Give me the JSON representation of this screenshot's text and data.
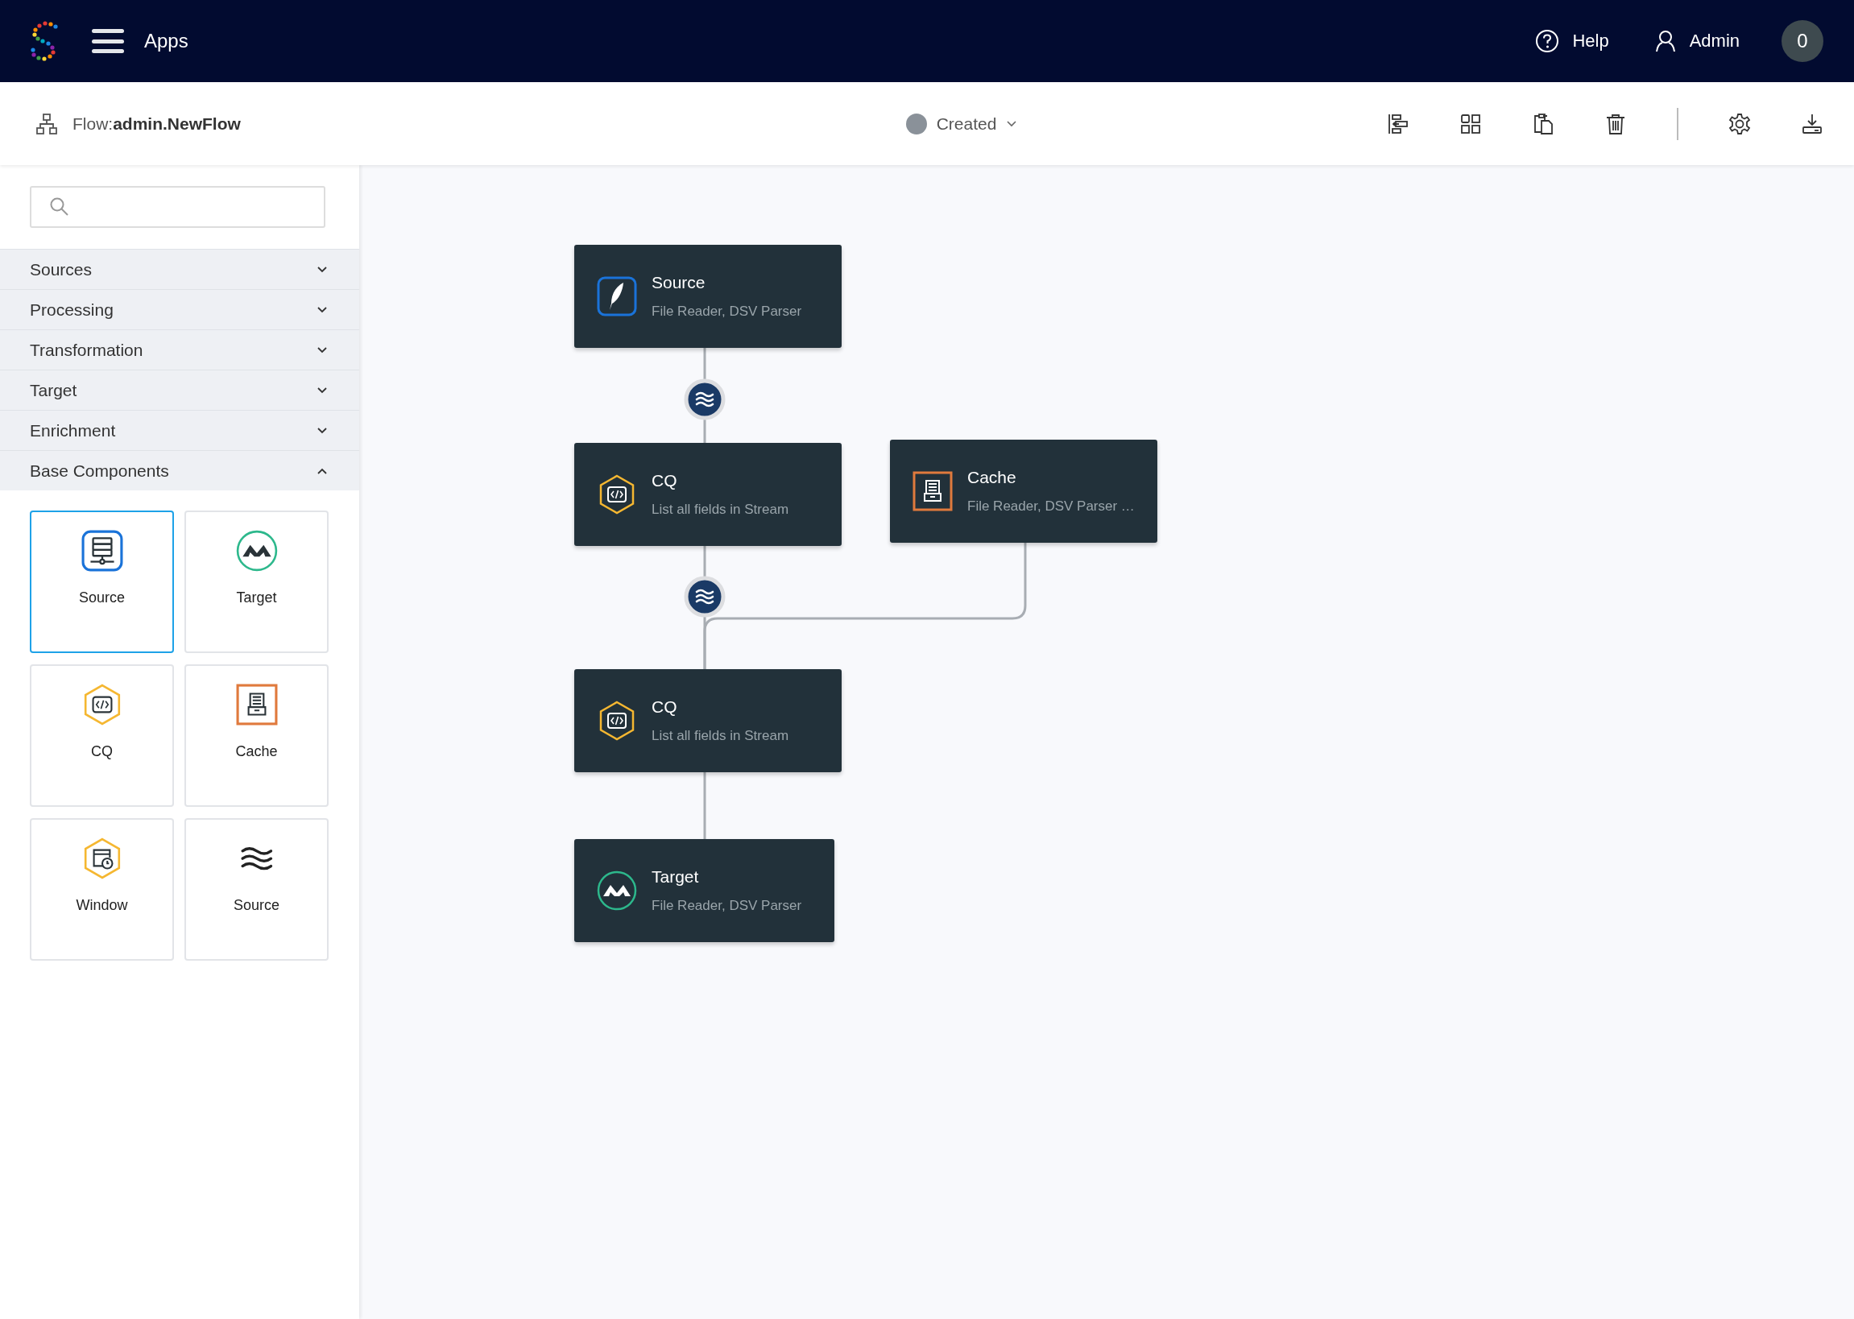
{
  "header": {
    "apps_label": "Apps",
    "help": "Help",
    "user": "Admin",
    "notification_count": "0"
  },
  "toolbar": {
    "flow_title": "Flow:**admin.NewFlow**",
    "status": "Created"
  },
  "sidebar": {
    "categories": [
      {
        "label": "Sources",
        "expanded": false
      },
      {
        "label": "Processing",
        "expanded": false
      },
      {
        "label": "Transformation",
        "expanded": false
      },
      {
        "label": "Target",
        "expanded": false
      },
      {
        "label": "Enrichment",
        "expanded": false
      },
      {
        "label": "Base Components",
        "expanded": true
      }
    ],
    "tiles": [
      {
        "label": "Source",
        "kind": "server",
        "selected": true
      },
      {
        "label": "Target",
        "kind": "peaks",
        "selected": false
      },
      {
        "label": "CQ",
        "kind": "code",
        "selected": false
      },
      {
        "label": "Cache",
        "kind": "drawer",
        "selected": false
      },
      {
        "label": "Window",
        "kind": "clock",
        "selected": false
      },
      {
        "label": "Source",
        "kind": "waves",
        "selected": false
      }
    ]
  },
  "canvas": {
    "nodes": [
      {
        "title": "Source",
        "subtitle": "File Reader, DSV Parser",
        "kind": "feather"
      },
      {
        "title": "CQ",
        "subtitle": "List all fields in Stream",
        "kind": "code"
      },
      {
        "title": "Cache",
        "subtitle": "File Reader, DSV Parser …",
        "kind": "drawer"
      },
      {
        "title": "CQ",
        "subtitle": "List all fields in Stream",
        "kind": "code"
      },
      {
        "title": "Target",
        "subtitle": "File Reader, DSV Parser",
        "kind": "peaks"
      }
    ]
  }
}
